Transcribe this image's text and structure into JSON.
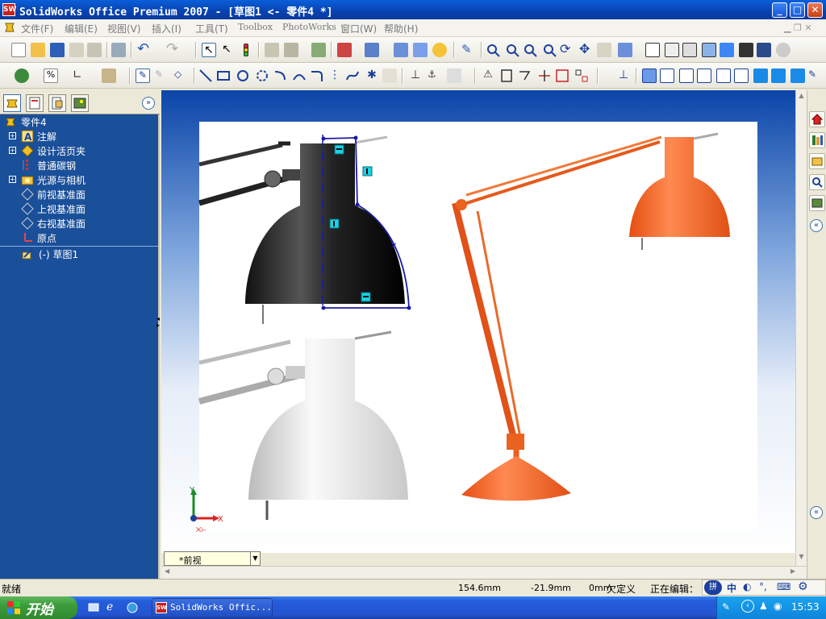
{
  "window": {
    "title": "SolidWorks Office Premium 2007 - [草图1 <- 零件4 *]",
    "logo_text": "SW",
    "min_label": "_",
    "max_label": "□",
    "close_label": "✕"
  },
  "menu": {
    "items": [
      "文件(F)",
      "编辑(E)",
      "视图(V)",
      "插入(I)",
      "工具(T)",
      "Toolbox",
      "PhotoWorks",
      "窗口(W)",
      "帮助(H)"
    ]
  },
  "feature_tree": {
    "collapse_label": "»",
    "items": [
      {
        "label": "零件4",
        "icon": "part-icon",
        "expandable": false
      },
      {
        "label": "注解",
        "icon": "annotation-icon",
        "expandable": true
      },
      {
        "label": "设计活页夹",
        "icon": "binder-icon",
        "expandable": true
      },
      {
        "label": "普通碳钢",
        "icon": "material-icon",
        "expandable": false
      },
      {
        "label": "光源与相机",
        "icon": "lights-icon",
        "expandable": true
      },
      {
        "label": "前视基准面",
        "icon": "plane-icon",
        "expandable": false
      },
      {
        "label": "上视基准面",
        "icon": "plane-icon",
        "expandable": false
      },
      {
        "label": "右视基准面",
        "icon": "plane-icon",
        "expandable": false
      },
      {
        "label": "原点",
        "icon": "origin-icon",
        "expandable": false
      },
      {
        "label": "(-) 草图1",
        "icon": "sketch-icon",
        "expandable": false
      }
    ]
  },
  "viewport": {
    "view_name": "*前视",
    "axis_y": "Y",
    "axis_x": "X"
  },
  "status": {
    "state": "就绪",
    "x": "154.6mm",
    "y": "-21.9mm",
    "z": "0mm",
    "definition": "欠定义",
    "editing": "正在编辑："
  },
  "taskbar": {
    "start_label": "开始",
    "task_label": "SolidWorks Offic...",
    "clock": "15:53",
    "ime_label": "中"
  },
  "colors": {
    "title_blue": "#0a4fc8",
    "tree_bg": "#1a4f99",
    "sketch_line": "#1a1aa8",
    "lamp_orange": "#e8521c",
    "relation_cyan": "#19d3e6"
  }
}
